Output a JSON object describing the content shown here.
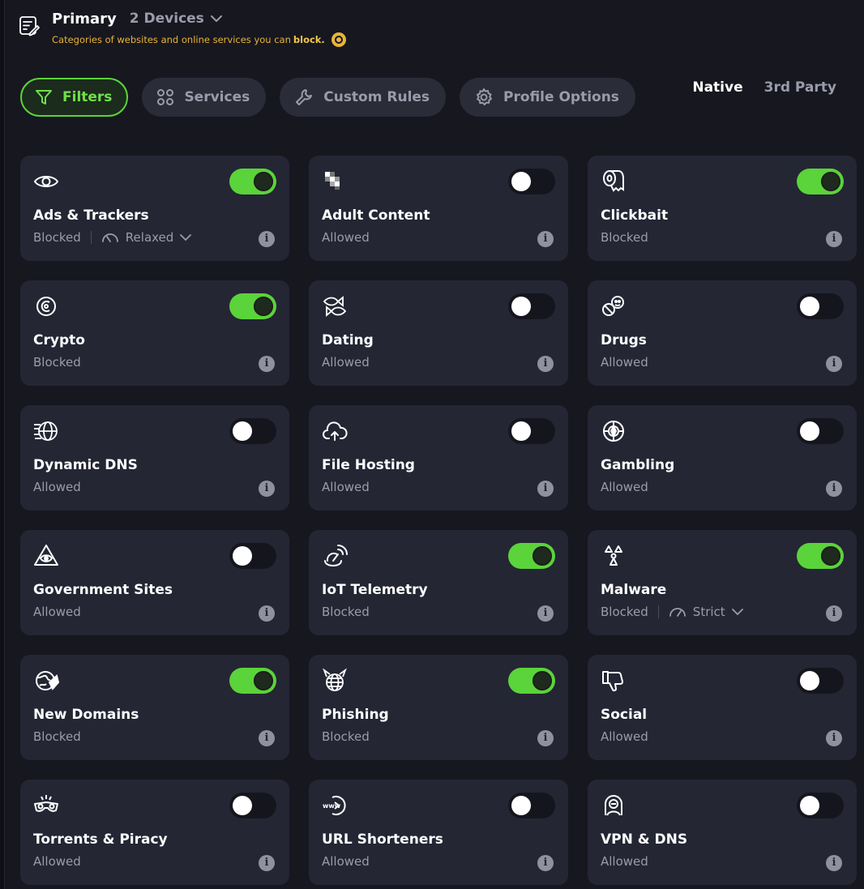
{
  "header": {
    "profile_name": "Primary",
    "devices_label": "2 Devices",
    "subtitle_prefix": "Categories of websites and online services you can",
    "subtitle_bold": "block."
  },
  "tabs": [
    {
      "label": "Filters",
      "active": true
    },
    {
      "label": "Services",
      "active": false
    },
    {
      "label": "Custom Rules",
      "active": false
    },
    {
      "label": "Profile Options",
      "active": false
    }
  ],
  "blocklist_source": {
    "native": "Native",
    "third_party": "3rd Party",
    "selected": "Native"
  },
  "colors": {
    "accent": "#5bd33a",
    "card": "#242634",
    "background": "#16171f",
    "muted": "#9a9cab",
    "warning": "#e9b43a"
  },
  "categories": [
    {
      "name": "Ads & Trackers",
      "status": "Blocked",
      "enabled": true,
      "level": "Relaxed",
      "icon": "eye-icon"
    },
    {
      "name": "Adult Content",
      "status": "Allowed",
      "enabled": false,
      "icon": "pixelated-icon"
    },
    {
      "name": "Clickbait",
      "status": "Blocked",
      "enabled": true,
      "icon": "toilet-paper-icon"
    },
    {
      "name": "Crypto",
      "status": "Blocked",
      "enabled": true,
      "icon": "crypto-coin-icon"
    },
    {
      "name": "Dating",
      "status": "Allowed",
      "enabled": false,
      "icon": "fish-icon"
    },
    {
      "name": "Drugs",
      "status": "Allowed",
      "enabled": false,
      "icon": "pills-icon"
    },
    {
      "name": "Dynamic DNS",
      "status": "Allowed",
      "enabled": false,
      "icon": "fast-globe-icon"
    },
    {
      "name": "File Hosting",
      "status": "Allowed",
      "enabled": false,
      "icon": "cloud-upload-icon"
    },
    {
      "name": "Gambling",
      "status": "Allowed",
      "enabled": false,
      "icon": "casino-chip-icon"
    },
    {
      "name": "Government Sites",
      "status": "Allowed",
      "enabled": false,
      "icon": "eye-pyramid-icon"
    },
    {
      "name": "IoT Telemetry",
      "status": "Blocked",
      "enabled": true,
      "icon": "satellite-dish-icon"
    },
    {
      "name": "Malware",
      "status": "Blocked",
      "enabled": true,
      "level": "Strict",
      "icon": "biohazard-icon"
    },
    {
      "name": "New Domains",
      "status": "Blocked",
      "enabled": true,
      "icon": "globe-tag-icon"
    },
    {
      "name": "Phishing",
      "status": "Blocked",
      "enabled": true,
      "icon": "devil-globe-icon"
    },
    {
      "name": "Social",
      "status": "Allowed",
      "enabled": false,
      "icon": "thumbs-down-icon"
    },
    {
      "name": "Torrents & Piracy",
      "status": "Allowed",
      "enabled": false,
      "icon": "pirate-mask-icon"
    },
    {
      "name": "URL Shorteners",
      "status": "Allowed",
      "enabled": false,
      "icon": "www-link-icon"
    },
    {
      "name": "VPN & DNS",
      "status": "Allowed",
      "enabled": false,
      "icon": "vpn-person-icon"
    }
  ]
}
